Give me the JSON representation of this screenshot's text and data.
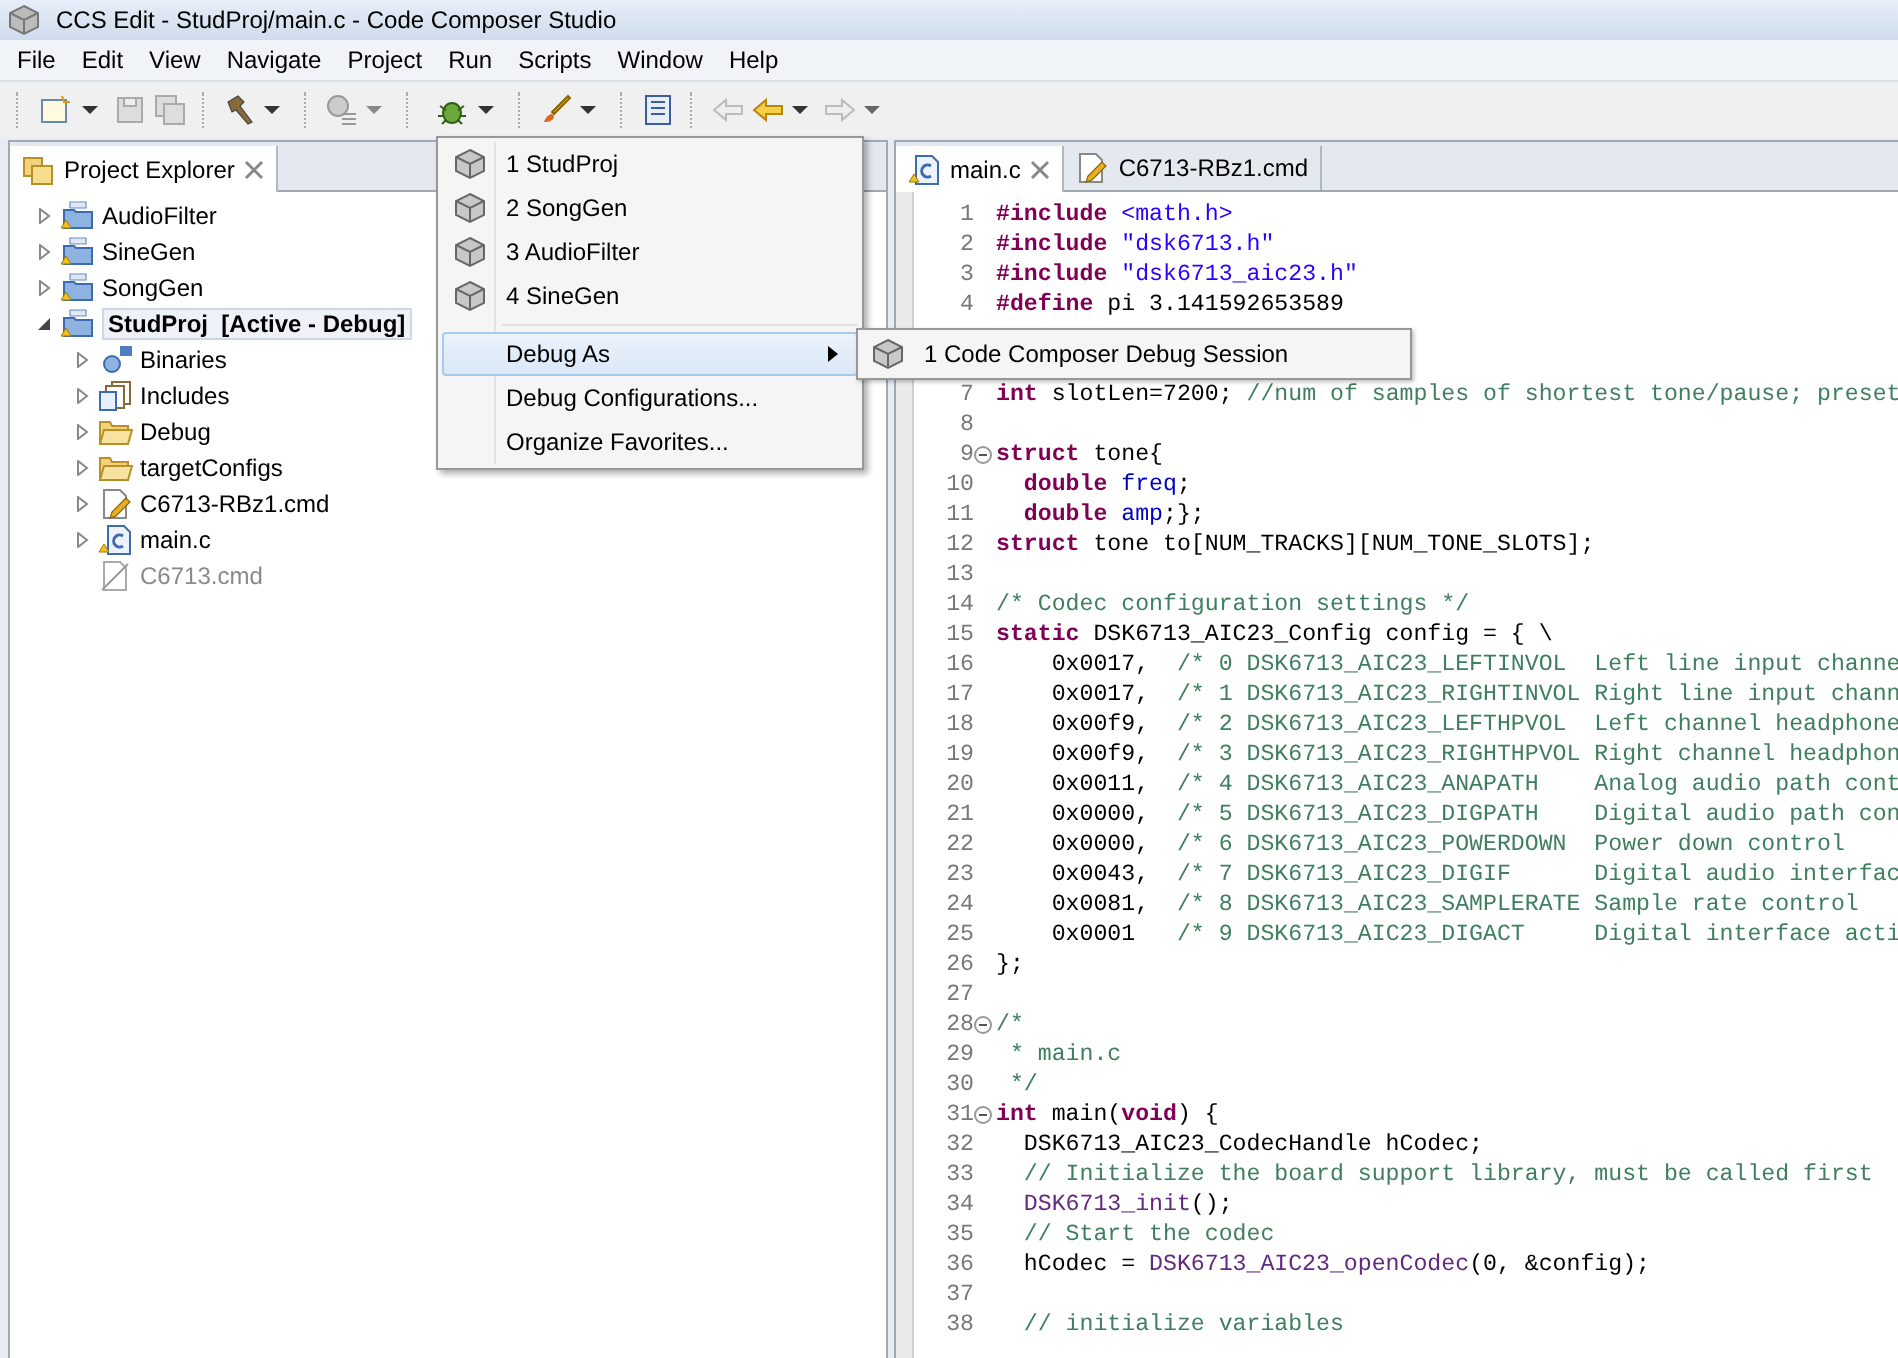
{
  "window": {
    "title": "CCS Edit - StudProj/main.c - Code Composer Studio"
  },
  "menu_bar": [
    "File",
    "Edit",
    "View",
    "Navigate",
    "Project",
    "Run",
    "Scripts",
    "Window",
    "Help"
  ],
  "project_explorer": {
    "tab": {
      "label": "Project Explorer",
      "selected": true
    },
    "tree": [
      {
        "label": "AudioFilter",
        "kind": "project",
        "expanded": false,
        "disabled": false
      },
      {
        "label": "SineGen",
        "kind": "project",
        "expanded": false,
        "disabled": false
      },
      {
        "label": "SongGen",
        "kind": "project",
        "expanded": false,
        "disabled": false
      },
      {
        "label": "StudProj  [Active - Debug]",
        "kind": "project",
        "active": true,
        "expanded": true,
        "disabled": false,
        "children": [
          {
            "label": "Binaries",
            "kind": "binaries",
            "expanded": false,
            "disabled": false
          },
          {
            "label": "Includes",
            "kind": "includes",
            "expanded": false,
            "disabled": false
          },
          {
            "label": "Debug",
            "kind": "folder",
            "expanded": false,
            "disabled": false
          },
          {
            "label": "targetConfigs",
            "kind": "folder",
            "expanded": false,
            "disabled": false
          },
          {
            "label": "C6713-RBz1.cmd",
            "kind": "cmd",
            "expanded": false,
            "disabled": false
          },
          {
            "label": "main.c",
            "kind": "c",
            "expanded": false,
            "disabled": false
          },
          {
            "label": "C6713.cmd",
            "kind": "cmd-excluded",
            "disabled": true
          }
        ]
      }
    ]
  },
  "debug_menu": {
    "items": [
      {
        "label": "1 StudProj",
        "kind": "favorite",
        "selected": false
      },
      {
        "label": "2 SongGen",
        "kind": "favorite",
        "selected": false
      },
      {
        "label": "3 AudioFilter",
        "kind": "favorite",
        "selected": false
      },
      {
        "label": "4 SineGen",
        "kind": "favorite",
        "selected": false
      },
      {
        "label": "Debug As",
        "kind": "submenu",
        "selected": true
      },
      {
        "label": "Debug Configurations...",
        "kind": "item",
        "selected": false
      },
      {
        "label": "Organize Favorites...",
        "kind": "item",
        "selected": false
      }
    ],
    "submenu": [
      {
        "label": "1 Code Composer Debug Session",
        "selected": false
      }
    ]
  },
  "editor": {
    "tabs": [
      {
        "label": "main.c",
        "kind": "c",
        "selected": true
      },
      {
        "label": "C6713-RBz1.cmd",
        "kind": "cmd",
        "selected": false
      }
    ],
    "lines": [
      {
        "n": "1",
        "segs": [
          {
            "kind": "kw",
            "t": "#include"
          },
          {
            "kind": "str",
            "t": " <math.h>"
          }
        ]
      },
      {
        "n": "2",
        "segs": [
          {
            "kind": "kw",
            "t": "#include"
          },
          {
            "kind": "str",
            "t": " \"dsk6713.h\""
          }
        ]
      },
      {
        "n": "3",
        "segs": [
          {
            "kind": "kw",
            "t": "#include"
          },
          {
            "kind": "str",
            "t": " \"dsk6713_aic23.h\""
          }
        ]
      },
      {
        "n": "4",
        "segs": [
          {
            "kind": "kw",
            "t": "#define"
          },
          {
            "kind": "plain",
            "t": " pi 3.141592653589"
          }
        ]
      },
      {
        "covered": true
      },
      {
        "covered": true
      },
      {
        "n": "7",
        "segs": [
          {
            "kind": "kw",
            "t": "int"
          },
          {
            "kind": "plain",
            "t": " slotLen=7200; "
          },
          {
            "kind": "cmt",
            "t": "//num of samples of shortest tone/pause; preset"
          }
        ]
      },
      {
        "n": "8"
      },
      {
        "n": "9",
        "fold": true,
        "segs": [
          {
            "kind": "kw",
            "t": "struct"
          },
          {
            "kind": "plain",
            "t": " tone{"
          }
        ]
      },
      {
        "n": "10",
        "segs": [
          {
            "kind": "kw",
            "t": "  double"
          },
          {
            "kind": "field",
            "t": " freq"
          },
          {
            "kind": "plain",
            "t": ";"
          }
        ]
      },
      {
        "n": "11",
        "segs": [
          {
            "kind": "kw",
            "t": "  double"
          },
          {
            "kind": "field",
            "t": " amp"
          },
          {
            "kind": "plain",
            "t": ";};"
          }
        ]
      },
      {
        "n": "12",
        "segs": [
          {
            "kind": "kw",
            "t": "struct"
          },
          {
            "kind": "plain",
            "t": " tone to[NUM_TRACKS][NUM_TONE_SLOTS];"
          }
        ]
      },
      {
        "n": "13"
      },
      {
        "n": "14",
        "segs": [
          {
            "kind": "cmt",
            "t": "/* Codec configuration settings */"
          }
        ]
      },
      {
        "n": "15",
        "segs": [
          {
            "kind": "kw",
            "t": "static"
          },
          {
            "kind": "plain",
            "t": " DSK6713_AIC23_Config config = { \\"
          }
        ]
      },
      {
        "n": "16",
        "segs": [
          {
            "kind": "plain",
            "t": "    0x0017,  "
          },
          {
            "kind": "cmt",
            "t": "/* 0 DSK6713_AIC23_LEFTINVOL  Left line input channe"
          }
        ]
      },
      {
        "n": "17",
        "segs": [
          {
            "kind": "plain",
            "t": "    0x0017,  "
          },
          {
            "kind": "cmt",
            "t": "/* 1 DSK6713_AIC23_RIGHTINVOL Right line input chann"
          }
        ]
      },
      {
        "n": "18",
        "segs": [
          {
            "kind": "plain",
            "t": "    0x00f9,  "
          },
          {
            "kind": "cmt",
            "t": "/* 2 DSK6713_AIC23_LEFTHPVOL  Left channel headphone"
          }
        ]
      },
      {
        "n": "19",
        "segs": [
          {
            "kind": "plain",
            "t": "    0x00f9,  "
          },
          {
            "kind": "cmt",
            "t": "/* 3 DSK6713_AIC23_RIGHTHPVOL Right channel headphon"
          }
        ]
      },
      {
        "n": "20",
        "segs": [
          {
            "kind": "plain",
            "t": "    0x0011,  "
          },
          {
            "kind": "cmt",
            "t": "/* 4 DSK6713_AIC23_ANAPATH    Analog audio path cont"
          }
        ]
      },
      {
        "n": "21",
        "segs": [
          {
            "kind": "plain",
            "t": "    0x0000,  "
          },
          {
            "kind": "cmt",
            "t": "/* 5 DSK6713_AIC23_DIGPATH    Digital audio path con"
          }
        ]
      },
      {
        "n": "22",
        "segs": [
          {
            "kind": "plain",
            "t": "    0x0000,  "
          },
          {
            "kind": "cmt",
            "t": "/* 6 DSK6713_AIC23_POWERDOWN  Power down control"
          }
        ]
      },
      {
        "n": "23",
        "segs": [
          {
            "kind": "plain",
            "t": "    0x0043,  "
          },
          {
            "kind": "cmt",
            "t": "/* 7 DSK6713_AIC23_DIGIF      Digital audio interfac"
          }
        ]
      },
      {
        "n": "24",
        "segs": [
          {
            "kind": "plain",
            "t": "    0x0081,  "
          },
          {
            "kind": "cmt",
            "t": "/* 8 DSK6713_AIC23_SAMPLERATE Sample rate control"
          }
        ]
      },
      {
        "n": "25",
        "segs": [
          {
            "kind": "plain",
            "t": "    0x0001   "
          },
          {
            "kind": "cmt",
            "t": "/* 9 DSK6713_AIC23_DIGACT     Digital interface acti"
          }
        ]
      },
      {
        "n": "26",
        "segs": [
          {
            "kind": "plain",
            "t": "};"
          }
        ]
      },
      {
        "n": "27"
      },
      {
        "n": "28",
        "fold": true,
        "segs": [
          {
            "kind": "cmt",
            "t": "/*"
          }
        ]
      },
      {
        "n": "29",
        "segs": [
          {
            "kind": "cmt",
            "t": " * main.c"
          }
        ]
      },
      {
        "n": "30",
        "segs": [
          {
            "kind": "cmt",
            "t": " */"
          }
        ]
      },
      {
        "n": "31",
        "fold": true,
        "segs": [
          {
            "kind": "kw",
            "t": "int"
          },
          {
            "kind": "plain",
            "t": " main("
          },
          {
            "kind": "kw",
            "t": "void"
          },
          {
            "kind": "plain",
            "t": ") {"
          }
        ]
      },
      {
        "n": "32",
        "segs": [
          {
            "kind": "plain",
            "t": "  DSK6713_AIC23_CodecHandle hCodec;"
          }
        ]
      },
      {
        "n": "33",
        "segs": [
          {
            "kind": "cmt",
            "t": "  // Initialize the board support library, must be called first"
          }
        ]
      },
      {
        "n": "34",
        "segs": [
          {
            "kind": "fn",
            "t": "  DSK6713_init"
          },
          {
            "kind": "plain",
            "t": "();"
          }
        ]
      },
      {
        "n": "35",
        "segs": [
          {
            "kind": "cmt",
            "t": "  // Start the codec"
          }
        ]
      },
      {
        "n": "36",
        "segs": [
          {
            "kind": "plain",
            "t": "  hCodec = "
          },
          {
            "kind": "fn",
            "t": "DSK6713_AIC23_openCodec"
          },
          {
            "kind": "plain",
            "t": "(0, &config);"
          }
        ]
      },
      {
        "n": "37"
      },
      {
        "n": "38",
        "segs": [
          {
            "kind": "cmt",
            "t": "  // initialize variables"
          }
        ]
      }
    ]
  }
}
